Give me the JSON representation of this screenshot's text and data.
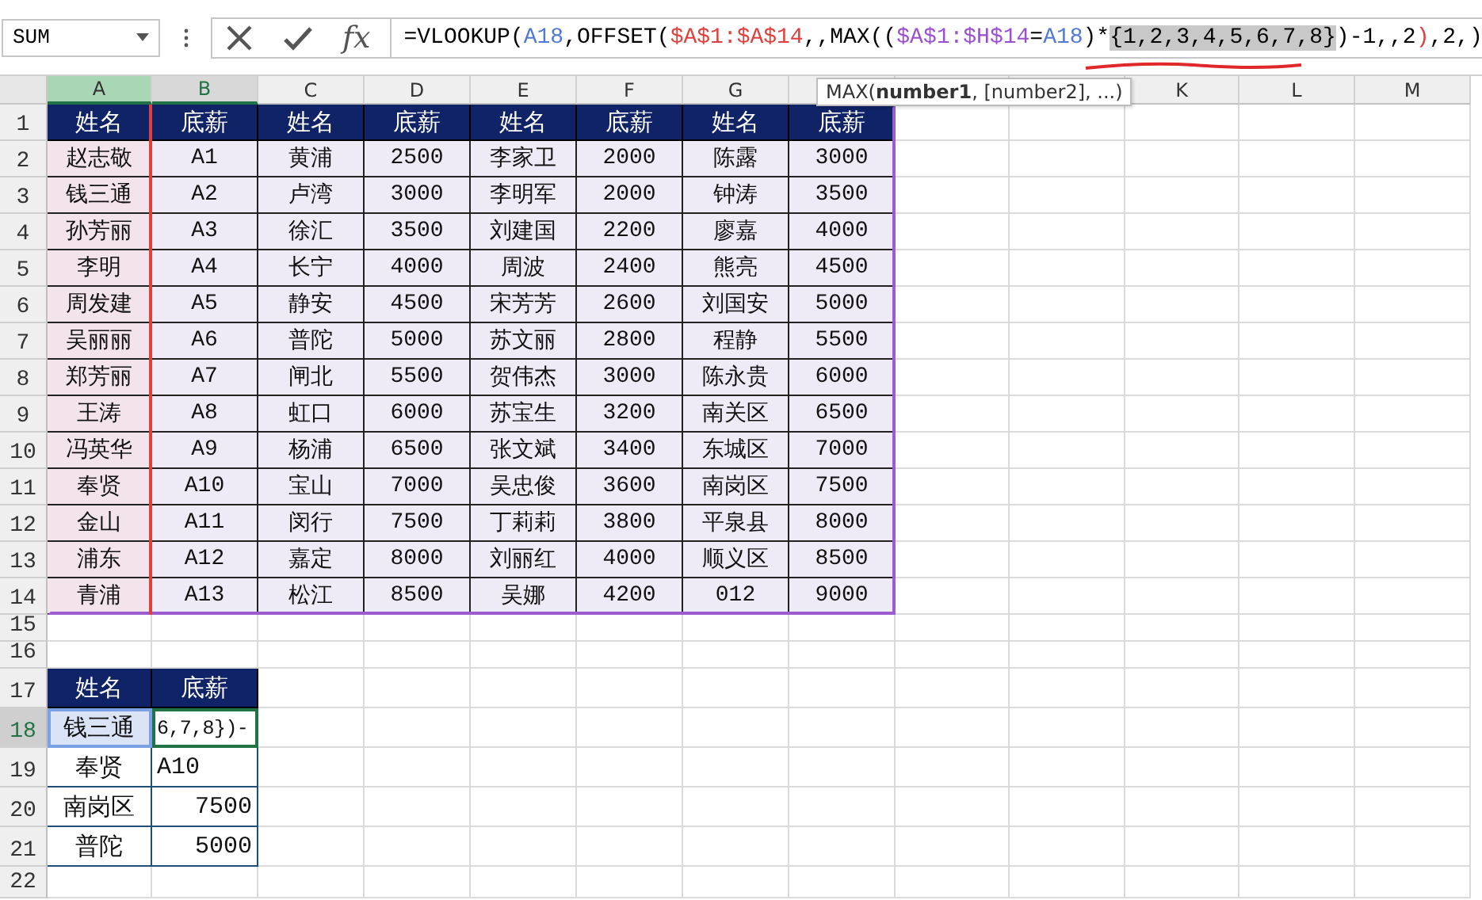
{
  "name_box": {
    "value": "SUM"
  },
  "formula_bar": {
    "fx_label": "fx",
    "segments": [
      {
        "text": "=VLOOKUP(",
        "color": "#000000",
        "selected": false
      },
      {
        "text": "A18",
        "color": "#4f78d8",
        "selected": false
      },
      {
        "text": ",OFFSET(",
        "color": "#000000",
        "selected": false
      },
      {
        "text": "$A$1:$A$14",
        "color": "#e0403c",
        "selected": false
      },
      {
        "text": ",,MAX((",
        "color": "#000000",
        "selected": false
      },
      {
        "text": "$A$1:$H$14",
        "color": "#9a4fd0",
        "selected": false
      },
      {
        "text": "=",
        "color": "#000000",
        "selected": false
      },
      {
        "text": "A18",
        "color": "#4f78d8",
        "selected": false
      },
      {
        "text": ")*",
        "color": "#000000",
        "selected": false
      },
      {
        "text": "{1,2,3,4,5,6,7,8}",
        "color": "#000000",
        "selected": true
      },
      {
        "text": ")-1,,2",
        "color": "#000000",
        "selected": false
      },
      {
        "text": ")",
        "color": "#e0403c",
        "selected": false
      },
      {
        "text": ",2,)",
        "color": "#000000",
        "selected": false
      }
    ]
  },
  "tooltip": {
    "text": "MAX(**number1**, [number2], ...)"
  },
  "columns": [
    {
      "label": "A",
      "selected": true
    },
    {
      "label": "B",
      "selected": true
    },
    {
      "label": "C",
      "selected": false
    },
    {
      "label": "D",
      "selected": false
    },
    {
      "label": "E",
      "selected": false
    },
    {
      "label": "F",
      "selected": false
    },
    {
      "label": "G",
      "selected": false
    },
    {
      "selected": false
    },
    {
      "selected": false
    },
    {
      "selected": false
    },
    {
      "label": "K",
      "selected": false
    },
    {
      "label": "L",
      "selected": false
    },
    {
      "label": "M",
      "selected": false
    }
  ],
  "row_numbers": [
    {
      "label": "1",
      "selected": false
    },
    {
      "label": "2",
      "selected": false
    },
    {
      "label": "3",
      "selected": false
    },
    {
      "label": "4",
      "selected": false
    },
    {
      "label": "5",
      "selected": false
    },
    {
      "label": "6",
      "selected": false
    },
    {
      "label": "7",
      "selected": false
    },
    {
      "label": "8",
      "selected": false
    },
    {
      "label": "9",
      "selected": false
    },
    {
      "label": "10",
      "selected": false
    },
    {
      "label": "11",
      "selected": false
    },
    {
      "label": "12",
      "selected": false
    },
    {
      "label": "13",
      "selected": false
    },
    {
      "label": "14",
      "selected": false
    },
    {
      "label": "15",
      "selected": false
    },
    {
      "label": "16",
      "selected": false
    },
    {
      "label": "17",
      "selected": false
    },
    {
      "label": "18",
      "selected": true
    },
    {
      "label": "19",
      "selected": false
    },
    {
      "label": "20",
      "selected": false
    },
    {
      "label": "21",
      "selected": false
    },
    {
      "label": "22",
      "selected": false
    }
  ],
  "main_table": {
    "header": [
      "姓名",
      "底薪",
      "姓名",
      "底薪",
      "姓名",
      "底薪",
      "姓名",
      "底薪"
    ],
    "rows": [
      [
        "赵志敬",
        "A1",
        "黄浦",
        "2500",
        "李家卫",
        "2000",
        "陈露",
        "3000"
      ],
      [
        "钱三通",
        "A2",
        "卢湾",
        "3000",
        "李明军",
        "2000",
        "钟涛",
        "3500"
      ],
      [
        "孙芳丽",
        "A3",
        "徐汇",
        "3500",
        "刘建国",
        "2200",
        "廖嘉",
        "4000"
      ],
      [
        "李明",
        "A4",
        "长宁",
        "4000",
        "周波",
        "2400",
        "熊亮",
        "4500"
      ],
      [
        "周发建",
        "A5",
        "静安",
        "4500",
        "宋芳芳",
        "2600",
        "刘国安",
        "5000"
      ],
      [
        "吴丽丽",
        "A6",
        "普陀",
        "5000",
        "苏文丽",
        "2800",
        "程静",
        "5500"
      ],
      [
        "郑芳丽",
        "A7",
        "闸北",
        "5500",
        "贺伟杰",
        "3000",
        "陈永贵",
        "6000"
      ],
      [
        "王涛",
        "A8",
        "虹口",
        "6000",
        "苏宝生",
        "3200",
        "南关区",
        "6500"
      ],
      [
        "冯英华",
        "A9",
        "杨浦",
        "6500",
        "张文斌",
        "3400",
        "东城区",
        "7000"
      ],
      [
        "奉贤",
        "A10",
        "宝山",
        "7000",
        "吴忠俊",
        "3600",
        "南岗区",
        "7500"
      ],
      [
        "金山",
        "A11",
        "闵行",
        "7500",
        "丁莉莉",
        "3800",
        "平泉县",
        "8000"
      ],
      [
        "浦东",
        "A12",
        "嘉定",
        "8000",
        "刘丽红",
        "4000",
        "顺义区",
        "8500"
      ],
      [
        "青浦",
        "A13",
        "松江",
        "8500",
        "吴娜",
        "4200",
        "012",
        "9000"
      ]
    ]
  },
  "lookup_table": {
    "header": [
      "姓名",
      "底薪"
    ],
    "rows": [
      {
        "name": "钱三通",
        "value": "6,7,8})-",
        "kind": "editing",
        "selected": true
      },
      {
        "name": "奉贤",
        "value": "A10",
        "kind": "text",
        "selected": false
      },
      {
        "name": "南岗区",
        "value": "7500",
        "kind": "number",
        "selected": false
      },
      {
        "name": "普陀",
        "value": "5000",
        "kind": "number",
        "selected": false
      }
    ]
  }
}
